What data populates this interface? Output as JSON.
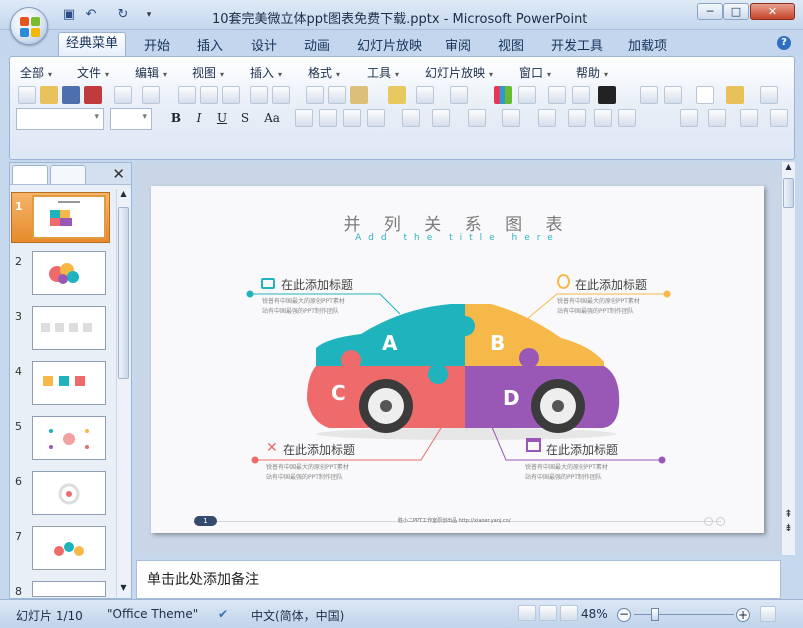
{
  "window": {
    "title": "10套完美微立体ppt图表免费下载.pptx - Microsoft PowerPoint",
    "minimize": "─",
    "maximize": "□",
    "close": "✕"
  },
  "ribbon_tabs": [
    "经典菜单",
    "开始",
    "插入",
    "设计",
    "动画",
    "幻灯片放映",
    "审阅",
    "视图",
    "开发工具",
    "加载项"
  ],
  "menu_items": [
    "全部",
    "文件",
    "编辑",
    "视图",
    "插入",
    "格式",
    "工具",
    "幻灯片放映",
    "窗口",
    "帮助"
  ],
  "format_buttons": [
    "B",
    "I",
    "U",
    "S",
    "Aa"
  ],
  "slide_thumbnails": [
    "1",
    "2",
    "3",
    "4",
    "5",
    "6",
    "7",
    "8"
  ],
  "slide": {
    "title": "并 列 关 系 图 表",
    "subtitle": "Add the title here",
    "pieces": [
      "A",
      "B",
      "C",
      "D"
    ],
    "callouts": [
      {
        "title": "在此添加标题",
        "desc1": "锐普有中国最大的原创PPT素材",
        "desc2": "站有中国最强的PPT制作团队"
      },
      {
        "title": "在此添加标题",
        "desc1": "锐普有中国最大的原创PPT素材",
        "desc2": "站有中国最强的PPT制作团队"
      },
      {
        "title": "在此添加标题",
        "desc1": "锐普有中国最大的原创PPT素材",
        "desc2": "站有中国最强的PPT制作团队"
      },
      {
        "title": "在此添加标题",
        "desc1": "锐普有中国最大的原创PPT素材",
        "desc2": "站有中国最强的PPT制作团队"
      }
    ],
    "page_number": "1",
    "footer": "胜小二PPT工作室原创出品  http://xiaoer.yanj.cn/",
    "colors": {
      "teal": "#1fb3bd",
      "orange": "#f7b84a",
      "coral": "#ef6b6b",
      "purple": "#9a58b6"
    }
  },
  "notes_placeholder": "单击此处添加备注",
  "status": {
    "slide_info": "幻灯片 1/10",
    "theme": "\"Office Theme\"",
    "language": "中文(简体，中国)",
    "zoom": "48%"
  }
}
